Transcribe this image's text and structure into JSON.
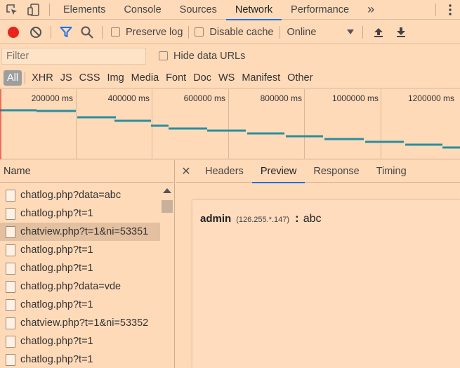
{
  "tabs": [
    {
      "label": "Elements"
    },
    {
      "label": "Console"
    },
    {
      "label": "Sources"
    },
    {
      "label": "Network"
    },
    {
      "label": "Performance"
    }
  ],
  "overflow_label": "»",
  "toolbar": {
    "preserve_log": "Preserve log",
    "disable_cache": "Disable cache",
    "throttle": "Online"
  },
  "filter": {
    "placeholder": "Filter",
    "hide_data_urls": "Hide data URLs"
  },
  "types": [
    "All",
    "XHR",
    "JS",
    "CSS",
    "Img",
    "Media",
    "Font",
    "Doc",
    "WS",
    "Manifest",
    "Other"
  ],
  "overview": {
    "ticks": [
      "200000 ms",
      "400000 ms",
      "600000 ms",
      "800000 ms",
      "1000000 ms",
      "1200000 ms"
    ]
  },
  "list": {
    "header": "Name",
    "rows": [
      "chatlog.php?data=abc",
      "chatlog.php?t=1",
      "chatview.php?t=1&ni=53351",
      "chatlog.php?t=1",
      "chatlog.php?t=1",
      "chatlog.php?data=vde",
      "chatlog.php?t=1",
      "chatview.php?t=1&ni=53352",
      "chatlog.php?t=1",
      "chatlog.php?t=1"
    ],
    "selected_index": 2
  },
  "detail": {
    "tabs": [
      "Headers",
      "Preview",
      "Response",
      "Timing"
    ],
    "active_tab": "Preview",
    "preview": {
      "user": "admin",
      "ip": "(126.255.*.147)",
      "colon": ":",
      "message": "abc"
    }
  },
  "colors": {
    "background": "#ffdab9",
    "accent": "#1a73e8",
    "record": "#e8241d",
    "waterfall": "#2a8f9e"
  }
}
